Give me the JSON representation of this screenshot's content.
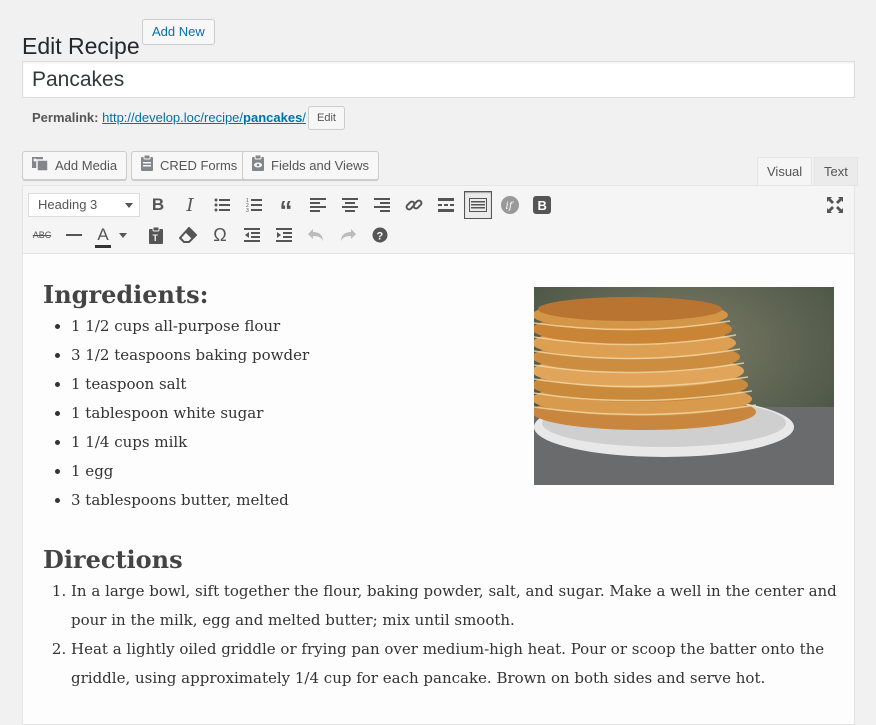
{
  "header": {
    "title": "Edit Recipe",
    "add_new_label": "Add New"
  },
  "post_title": {
    "value": "Pancakes"
  },
  "permalink": {
    "label": "Permalink:",
    "url_prefix": "http://develop.loc/recipe/",
    "slug": "pancakes",
    "url_suffix": "/",
    "edit_label": "Edit"
  },
  "media_buttons": [
    {
      "label": "Add Media",
      "icon": "add-media-icon"
    },
    {
      "label": "CRED Forms",
      "icon": "clipboard-icon"
    },
    {
      "label": "Fields and Views",
      "icon": "fields-views-icon"
    }
  ],
  "tabs": {
    "visual": "Visual",
    "text": "Text"
  },
  "toolbar": {
    "format_value": "Heading 3"
  },
  "content": {
    "ingredients_heading": "Ingredients:",
    "ingredients": [
      "1 1/2 cups all-purpose flour",
      "3 1/2 teaspoons baking powder",
      "1 teaspoon salt",
      "1 tablespoon white sugar",
      "1 1/4 cups milk",
      "1 egg",
      "3 tablespoons butter, melted"
    ],
    "directions_heading": "Directions",
    "directions": [
      "In a large bowl, sift together the flour, baking powder, salt, and sugar. Make a well in the center and pour in the milk, egg and melted butter; mix until smooth.",
      "Heat a lightly oiled griddle or frying pan over medium-high heat. Pour or scoop the batter onto the griddle, using approximately 1/4 cup for each pancake. Brown on both sides and serve hot."
    ]
  },
  "colors": {
    "link": "#0073aa",
    "background": "#f1f1f1",
    "text": "#23282d"
  }
}
